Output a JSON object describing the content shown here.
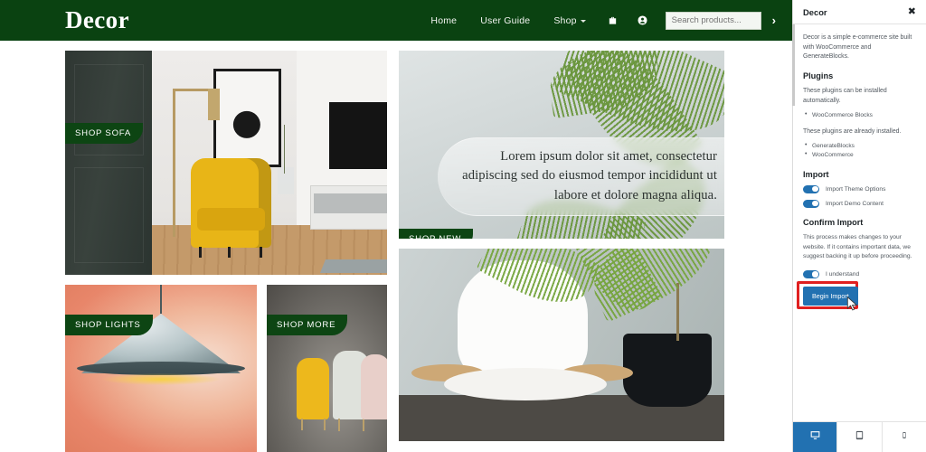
{
  "site": {
    "logo": "Decor",
    "nav": [
      {
        "label": "Home",
        "icon": null
      },
      {
        "label": "User Guide",
        "icon": null
      },
      {
        "label": "Shop",
        "icon": "chevron-down-icon"
      }
    ],
    "cart_icon": "cart-icon",
    "account_icon": "account-icon",
    "search": {
      "placeholder": "Search products...",
      "value": "",
      "submit_label": "›"
    }
  },
  "cards": {
    "sofa_badge": "SHOP SOFA",
    "lights_badge": "SHOP LIGHTS",
    "more_badge": "SHOP MORE",
    "new_badge": "SHOP NEW",
    "hero_text": "Lorem ipsum dolor sit amet, consectetur adipiscing sed do eiusmod tempor incididunt ut labore et dolore magna aliqua."
  },
  "sidebar": {
    "title": "Decor",
    "close_icon": "close-icon",
    "description": "Decor is a simple e-commerce site built with WooCommerce and GenerateBlocks.",
    "plugins": {
      "heading": "Plugins",
      "auto_note": "These plugins can be installed automatically.",
      "auto_list": [
        "WooCommerce Blocks"
      ],
      "installed_note": "These plugins are already installed.",
      "installed_list": [
        "GenerateBlocks",
        "WooCommerce"
      ]
    },
    "import": {
      "heading": "Import",
      "toggles": [
        {
          "label": "Import Theme Options",
          "on": true
        },
        {
          "label": "Import Demo Content",
          "on": true
        }
      ]
    },
    "confirm": {
      "heading": "Confirm Import",
      "warning": "This process makes changes to your website. If it contains important data, we suggest backing it up before proceeding.",
      "understand_label": "I understand",
      "understand_on": true,
      "button_label": "Begin Import"
    },
    "devices": [
      {
        "name": "desktop",
        "icon": "desktop-icon",
        "active": true
      },
      {
        "name": "tablet",
        "icon": "tablet-icon",
        "active": false
      },
      {
        "name": "mobile",
        "icon": "mobile-icon",
        "active": false
      }
    ]
  },
  "colors": {
    "brand_green": "#0a4211",
    "badge_green": "#0d4513",
    "wp_blue": "#2271b1",
    "highlight_red": "#e02020"
  }
}
